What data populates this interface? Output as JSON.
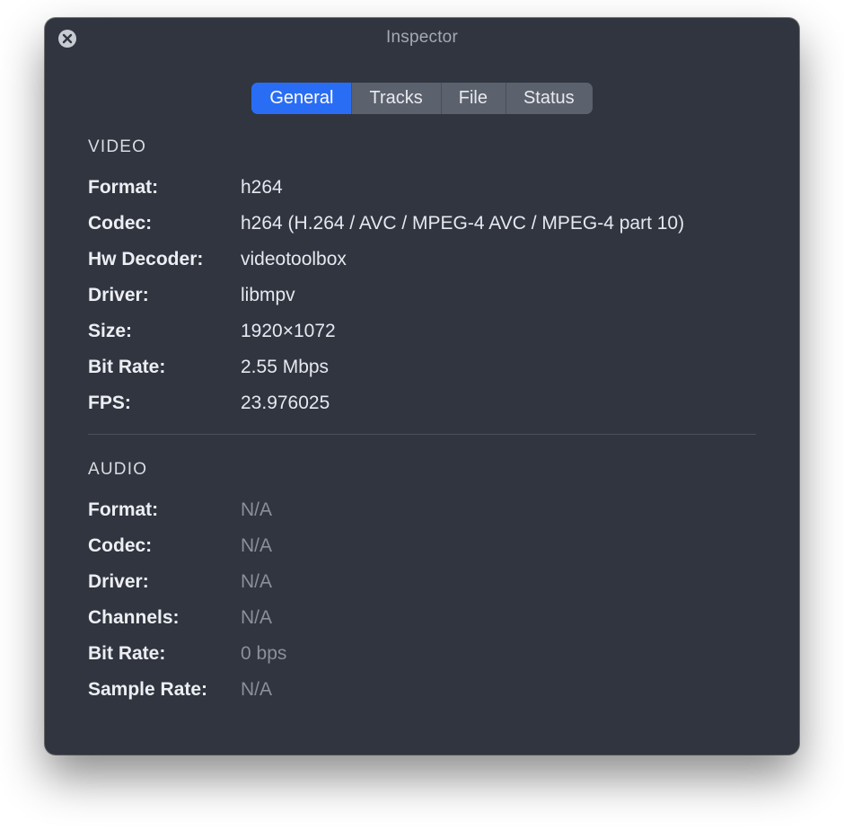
{
  "window": {
    "title": "Inspector"
  },
  "tabs": {
    "general": "General",
    "tracks": "Tracks",
    "file": "File",
    "status": "Status"
  },
  "sections": {
    "video": {
      "heading": "VIDEO",
      "rows": {
        "format": {
          "label": "Format:",
          "value": "h264"
        },
        "codec": {
          "label": "Codec:",
          "value": "h264 (H.264 / AVC / MPEG-4 AVC / MPEG-4 part 10)"
        },
        "hw_decoder": {
          "label": "Hw Decoder:",
          "value": "videotoolbox"
        },
        "driver": {
          "label": "Driver:",
          "value": "libmpv"
        },
        "size": {
          "label": "Size:",
          "value": "1920×1072"
        },
        "bit_rate": {
          "label": "Bit Rate:",
          "value": "2.55 Mbps"
        },
        "fps": {
          "label": "FPS:",
          "value": "23.976025"
        }
      }
    },
    "audio": {
      "heading": "AUDIO",
      "rows": {
        "format": {
          "label": "Format:",
          "value": "N/A"
        },
        "codec": {
          "label": "Codec:",
          "value": "N/A"
        },
        "driver": {
          "label": "Driver:",
          "value": "N/A"
        },
        "channels": {
          "label": "Channels:",
          "value": "N/A"
        },
        "bit_rate": {
          "label": "Bit Rate:",
          "value": "0 bps"
        },
        "sample_rate": {
          "label": "Sample Rate:",
          "value": "N/A"
        }
      }
    }
  }
}
